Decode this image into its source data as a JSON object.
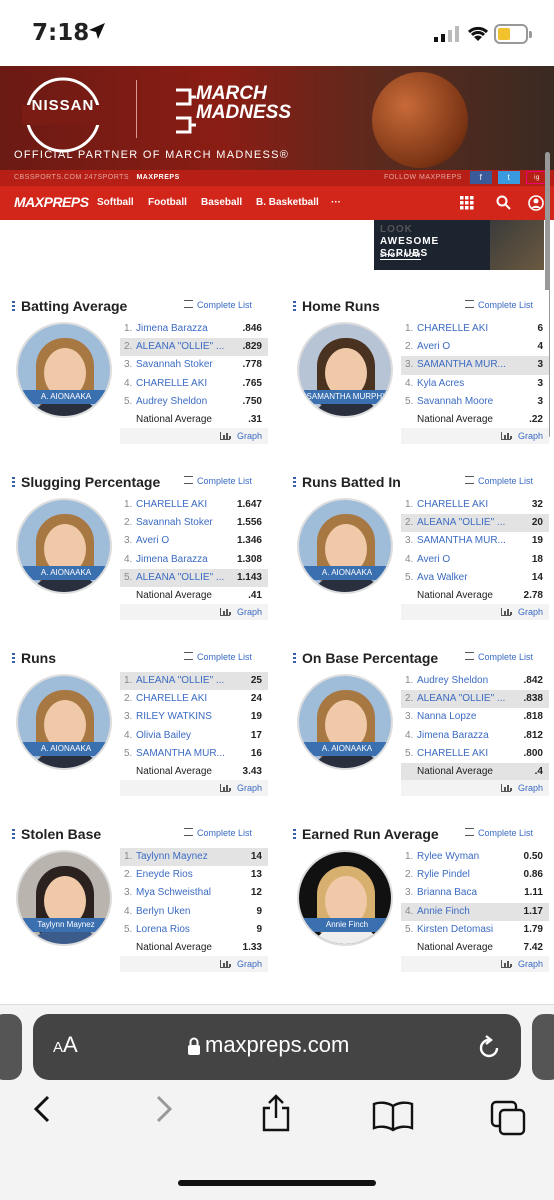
{
  "status": {
    "time": "7:18"
  },
  "ad": {
    "brand": "NISSAN",
    "event_line1": "MARCH",
    "event_line2": "MADNESS",
    "tagline": "OFFICIAL PARTNER OF MARCH MADNESS®"
  },
  "topbar": {
    "links": "CBSSPORTS.COM   247SPORTS",
    "active": "MAXPREPS",
    "follow": "FOLLOW MAXPREPS",
    "social": [
      "f",
      "t",
      "ig"
    ]
  },
  "nav": {
    "logo": "MAXPREPS",
    "items": [
      "Softball",
      "Football",
      "Baseball",
      "B. Basketball",
      "···"
    ]
  },
  "ad2": {
    "line1": "LOOK",
    "line2": "AWESOME",
    "line3": "SCRUBS",
    "cta": "SHOP NOW"
  },
  "common": {
    "complete_list": "Complete List",
    "graph": "Graph",
    "national_average": "National Average"
  },
  "cards": [
    {
      "title": "Batting Average",
      "photo_name": "A. AIONAAKA",
      "rows": [
        {
          "rank": "1.",
          "name": "Jimena Barazza",
          "value": ".846"
        },
        {
          "rank": "2.",
          "name": "ALEANA \"OLLIE\" ...",
          "value": ".829"
        },
        {
          "rank": "3.",
          "name": "Savannah Stoker",
          "value": ".778"
        },
        {
          "rank": "4.",
          "name": "CHARELLE AKI",
          "value": ".765"
        },
        {
          "rank": "5.",
          "name": "Audrey Sheldon",
          "value": ".750"
        }
      ],
      "national": ".31"
    },
    {
      "title": "Home Runs",
      "photo_name": "SAMANTHA MURPHY",
      "rows": [
        {
          "rank": "1.",
          "name": "CHARELLE AKI",
          "value": "6"
        },
        {
          "rank": "2.",
          "name": "Averi O",
          "value": "4"
        },
        {
          "rank": "3.",
          "name": "SAMANTHA MUR...",
          "value": "3"
        },
        {
          "rank": "4.",
          "name": "Kyla Acres",
          "value": "3"
        },
        {
          "rank": "5.",
          "name": "Savannah Moore",
          "value": "3"
        }
      ],
      "national": ".22"
    },
    {
      "title": "Slugging Percentage",
      "photo_name": "A. AIONAAKA",
      "rows": [
        {
          "rank": "1.",
          "name": "CHARELLE AKI",
          "value": "1.647"
        },
        {
          "rank": "2.",
          "name": "Savannah Stoker",
          "value": "1.556"
        },
        {
          "rank": "3.",
          "name": "Averi O",
          "value": "1.346"
        },
        {
          "rank": "4.",
          "name": "Jimena Barazza",
          "value": "1.308"
        },
        {
          "rank": "5.",
          "name": "ALEANA \"OLLIE\" ...",
          "value": "1.143"
        }
      ],
      "national": ".41"
    },
    {
      "title": "Runs Batted In",
      "photo_name": "A. AIONAAKA",
      "rows": [
        {
          "rank": "1.",
          "name": "CHARELLE AKI",
          "value": "32"
        },
        {
          "rank": "2.",
          "name": "ALEANA \"OLLIE\" ...",
          "value": "20"
        },
        {
          "rank": "3.",
          "name": "SAMANTHA MUR...",
          "value": "19"
        },
        {
          "rank": "4.",
          "name": "Averi O",
          "value": "18"
        },
        {
          "rank": "5.",
          "name": "Ava Walker",
          "value": "14"
        }
      ],
      "national": "2.78"
    },
    {
      "title": "Runs",
      "photo_name": "A. AIONAAKA",
      "rows": [
        {
          "rank": "1.",
          "name": "ALEANA \"OLLIE\" ...",
          "value": "25"
        },
        {
          "rank": "2.",
          "name": "CHARELLE AKI",
          "value": "24"
        },
        {
          "rank": "3.",
          "name": "RILEY WATKINS",
          "value": "19"
        },
        {
          "rank": "4.",
          "name": "Olivia Bailey",
          "value": "17"
        },
        {
          "rank": "5.",
          "name": "SAMANTHA MUR...",
          "value": "16"
        }
      ],
      "national": "3.43"
    },
    {
      "title": "On Base Percentage",
      "photo_name": "A. AIONAAKA",
      "rows": [
        {
          "rank": "1.",
          "name": "Audrey Sheldon",
          "value": ".842"
        },
        {
          "rank": "2.",
          "name": "ALEANA \"OLLIE\" ...",
          "value": ".838"
        },
        {
          "rank": "3.",
          "name": "Nanna Lopze",
          "value": ".818"
        },
        {
          "rank": "4.",
          "name": "Jimena Barazza",
          "value": ".812"
        },
        {
          "rank": "5.",
          "name": "CHARELLE AKI",
          "value": ".800"
        }
      ],
      "national": ".4"
    },
    {
      "title": "Stolen Base",
      "photo_name": "Taylynn Maynez",
      "rows": [
        {
          "rank": "1.",
          "name": "Taylynn Maynez",
          "value": "14"
        },
        {
          "rank": "2.",
          "name": "Eneyde Rios",
          "value": "13"
        },
        {
          "rank": "3.",
          "name": "Mya Schweisthal",
          "value": "12"
        },
        {
          "rank": "4.",
          "name": "Berlyn Uken",
          "value": "9"
        },
        {
          "rank": "5.",
          "name": "Lorena Rios",
          "value": "9"
        }
      ],
      "national": "1.33"
    },
    {
      "title": "Earned Run Average",
      "photo_name": "Annie Finch",
      "rows": [
        {
          "rank": "1.",
          "name": "Rylee Wyman",
          "value": "0.50"
        },
        {
          "rank": "2.",
          "name": "Rylie Pindel",
          "value": "0.86"
        },
        {
          "rank": "3.",
          "name": "Brianna Baca",
          "value": "1.11"
        },
        {
          "rank": "4.",
          "name": "Annie Finch",
          "value": "1.17"
        },
        {
          "rank": "5.",
          "name": "Kirsten Detomasi",
          "value": "1.79"
        }
      ],
      "national": "7.42"
    }
  ],
  "browser": {
    "aa": "AA",
    "url": "maxpreps.com"
  }
}
